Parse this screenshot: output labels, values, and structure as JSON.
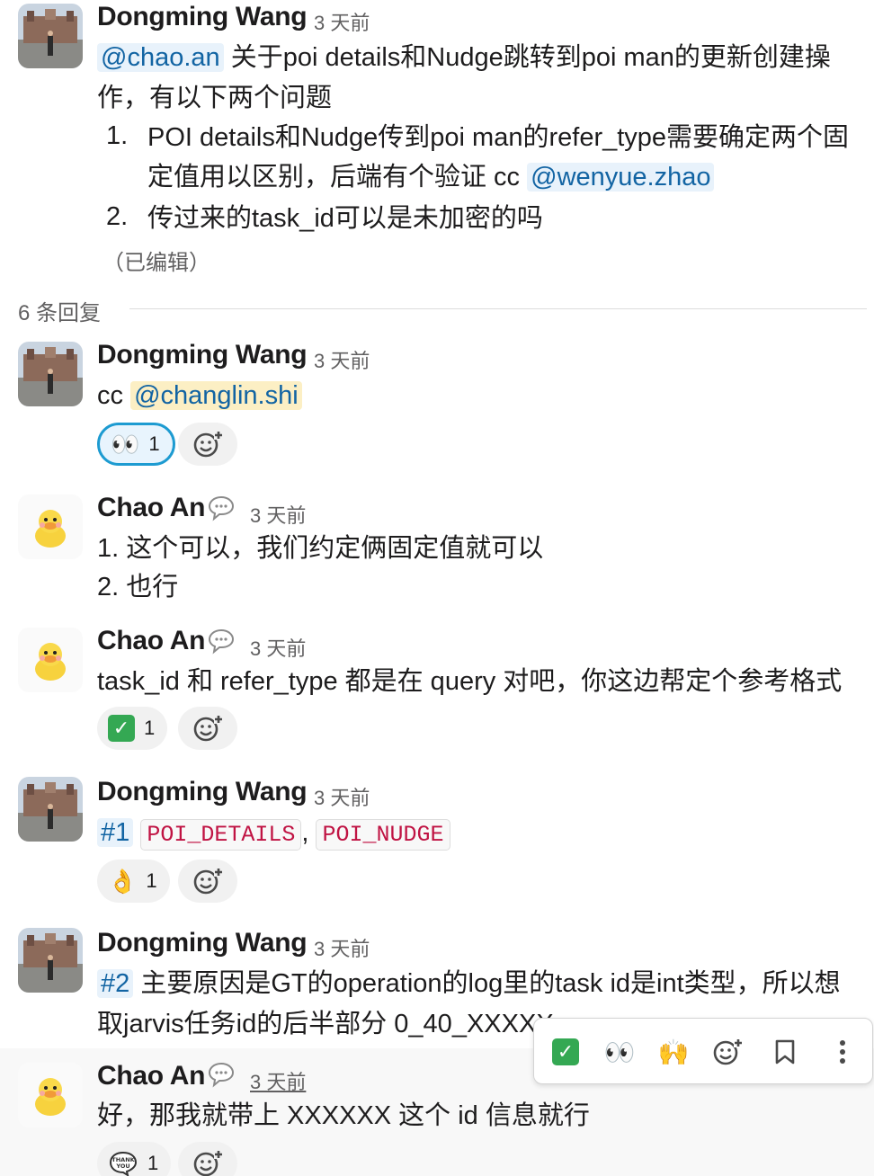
{
  "thread": {
    "replies_label": "6 条回复",
    "root": {
      "author": "Dongming Wang",
      "time": "3 天前",
      "mention": "@chao.an",
      "line1_rest": " 关于poi details和Nudge跳转到poi man的更新创建操",
      "line2": "作，有以下两个问题",
      "items": [
        {
          "num": "1.",
          "line1": "POI details和Nudge传到poi man的refer_type需要确定两个固",
          "line2_text": "定值用以区别，后端有个验证 cc ",
          "line2_mention": "@wenyue.zhao"
        },
        {
          "num": "2.",
          "line1": "传过来的task_id可以是未加密的吗"
        }
      ],
      "edited": "（已编辑）"
    },
    "replies": [
      {
        "author": "Dongming Wang",
        "time": "3 天前",
        "text_prefix": "cc ",
        "mention": "@changlin.shi",
        "reaction": {
          "emoji": "👀",
          "count": "1",
          "mine": true
        }
      },
      {
        "author": "Chao An",
        "time": "3 天前",
        "status_icon": "speech-bubble-icon",
        "lines": [
          "1. 这个可以，我们约定俩固定值就可以",
          "2. 也行"
        ]
      },
      {
        "author": "Chao An",
        "time": "3 天前",
        "status_icon": "speech-bubble-icon",
        "text": "task_id 和 refer_type 都是在 query 对吧，你这边帮定个参考格式",
        "reaction": {
          "emoji": "check-mark-icon",
          "count": "1"
        }
      },
      {
        "author": "Dongming Wang",
        "time": "3 天前",
        "ref": "#1",
        "code1": "POI_DETAILS",
        "sep": ",",
        "code2": "POI_NUDGE",
        "reaction": {
          "emoji": "👌",
          "count": "1"
        }
      },
      {
        "author": "Dongming Wang",
        "time": "3 天前",
        "ref": "#2",
        "line1_rest": " 主要原因是GT的operation的log里的task id是int类型，所以想",
        "line2": "取jarvis任务id的后半部分 0_40_XXXXX"
      },
      {
        "author": "Chao An",
        "time": "3 天前",
        "status_icon": "speech-bubble-icon",
        "text": "好，那我就带上 XXXXXX 这个 id 信息就行",
        "reaction": {
          "emoji": "thank-you-icon",
          "count": "1"
        }
      }
    ]
  },
  "hover_toolbar": {
    "buttons": [
      "check-mark-icon",
      "eyes-icon",
      "raised-hands-icon",
      "add-reaction-icon",
      "bookmark-icon",
      "more-actions-icon"
    ],
    "eyes_glyph": "👀",
    "hands_glyph": "🙌"
  },
  "colors": {
    "mention_bg": "#e8f2fb",
    "mention_text": "#1264a3",
    "self_mention_bg": "#fcefc4",
    "code_text": "#c01343",
    "reaction_mine_border": "#1d9bd1"
  }
}
